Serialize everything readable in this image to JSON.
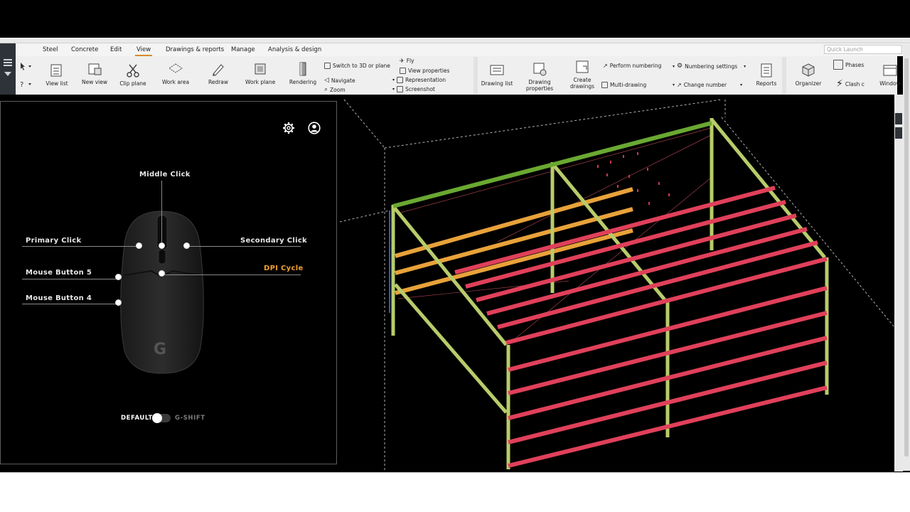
{
  "menu": {
    "items": [
      "Steel",
      "Concrete",
      "Edit",
      "View",
      "Drawings & reports",
      "Manage",
      "Analysis & design"
    ],
    "active": "View",
    "quick_launch_placeholder": "Quick Launch"
  },
  "ribbon": {
    "view_list": "View list",
    "new_view": "New view",
    "clip_plane": "Clip plane",
    "work_area": "Work area",
    "redraw": "Redraw",
    "work_plane": "Work plane",
    "rendering": "Rendering",
    "switch_3d": "Switch to 3D or plane",
    "navigate": "Navigate",
    "zoom": "Zoom",
    "fly": "Fly",
    "view_properties": "View properties",
    "representation": "Representation",
    "screenshot": "Screenshot",
    "drawing_list": "Drawing list",
    "drawing_properties_1": "Drawing",
    "drawing_properties_2": "properties",
    "create_drawings_1": "Create",
    "create_drawings_2": "drawings",
    "perform_numbering": "Perform numbering",
    "multi_drawing": "Multi-drawing",
    "numbering_settings": "Numbering settings",
    "change_number": "Change number",
    "reports": "Reports",
    "organizer": "Organizer",
    "phases": "Phases",
    "clash": "Clash c",
    "window": "Window"
  },
  "ghub": {
    "middle_click": "Middle Click",
    "primary_click": "Primary Click",
    "secondary_click": "Secondary Click",
    "mouse_button_5": "Mouse Button 5",
    "dpi_cycle": "DPI Cycle",
    "mouse_button_4": "Mouse Button 4",
    "mode_default": "DEFAULT",
    "mode_gshift": "G-SHIFT",
    "gshift_enabled": false
  },
  "colors": {
    "accent_orange": "#f0a030",
    "beam_red": "#e0405a",
    "beam_orange": "#e8a23a",
    "beam_green": "#6aa832",
    "column_green": "#b8cc6a"
  }
}
